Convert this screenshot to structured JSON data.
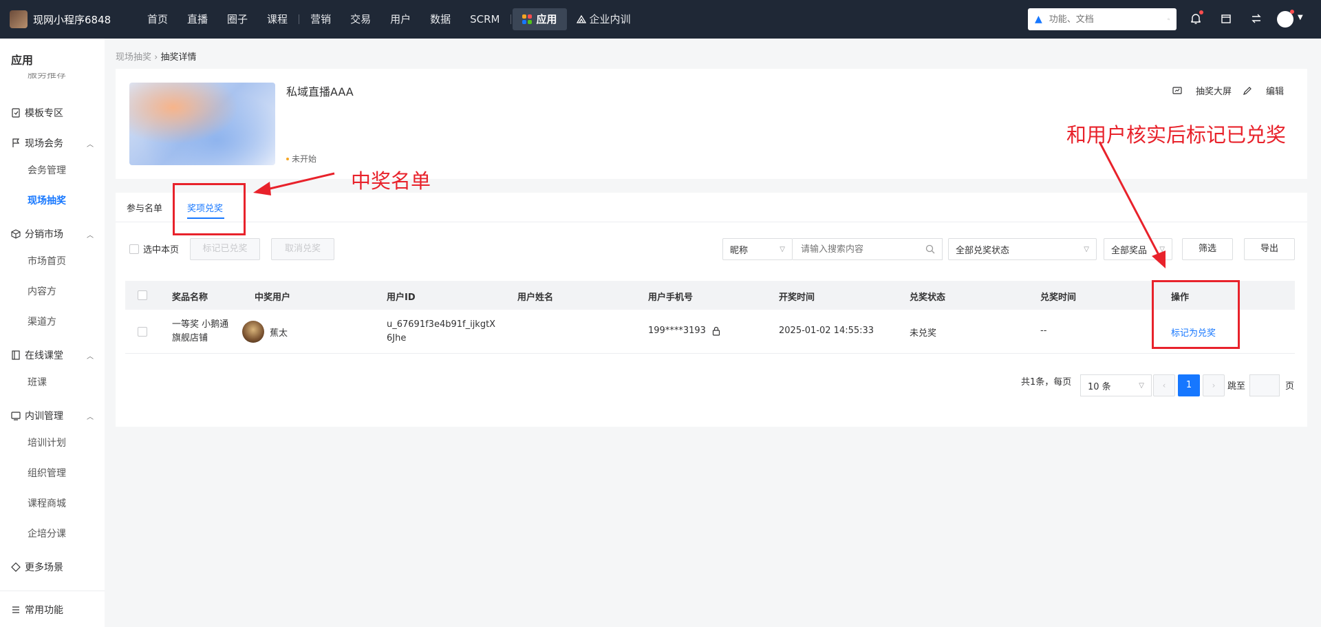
{
  "topbar": {
    "brand": "现网小程序6848",
    "nav": [
      "首页",
      "直播",
      "圈子",
      "课程",
      "营销",
      "交易",
      "用户",
      "数据",
      "SCRM"
    ],
    "nav_active": "应用",
    "nav_train": "企业内训",
    "search_placeholder": "功能、文档",
    "icons": [
      "bell-icon",
      "store-icon",
      "switch-icon",
      "avatar"
    ]
  },
  "sidebar": {
    "title": "应用",
    "clipped_item": "服务推荐",
    "template": "模板专区",
    "groups": [
      {
        "label": "现场会务",
        "items": [
          "会务管理",
          "现场抽奖"
        ]
      },
      {
        "label": "分销市场",
        "items": [
          "市场首页",
          "内容方",
          "渠道方"
        ]
      },
      {
        "label": "在线课堂",
        "items": [
          "班课"
        ]
      },
      {
        "label": "内训管理",
        "items": [
          "培训计划",
          "组织管理",
          "课程商城",
          "企培分课"
        ]
      }
    ],
    "more": "更多场景",
    "common": "常用功能"
  },
  "breadcrumb": {
    "parent": "现场抽奖",
    "current": "抽奖详情"
  },
  "live": {
    "title": "私域直播AAA",
    "status": "未开始",
    "big_screen": "抽奖大屏",
    "edit": "编辑"
  },
  "tabs": [
    "参与名单",
    "奖项兑奖"
  ],
  "toolbar": {
    "select_page": "选中本页",
    "mark_redeemed": "标记已兑奖",
    "cancel_redeem": "取消兑奖",
    "field_select": "昵称",
    "search_placeholder": "请输入搜索内容",
    "status_select": "全部兑奖状态",
    "prize_select": "全部奖品",
    "filter": "筛选",
    "export": "导出"
  },
  "table": {
    "headers": [
      "奖品名称",
      "中奖用户",
      "用户ID",
      "用户姓名",
      "用户手机号",
      "开奖时间",
      "兑奖状态",
      "兑奖时间",
      "操作"
    ],
    "rows": [
      {
        "prize_line1": "一等奖 小鹅通",
        "prize_line2": "旗舰店铺",
        "winner": "蕉太",
        "uid_line1": "u_67691f3e4b91f_ijkgtX",
        "uid_line2": "6Jhe",
        "name": "",
        "phone": "199****3193",
        "draw_time": "2025-01-02 14:55:33",
        "status": "未兑奖",
        "redeem_time": "--",
        "action": "标记为兑奖"
      }
    ]
  },
  "pagination": {
    "summary": "共1条，每页",
    "page_size": "10 条",
    "current": "1",
    "jump": "跳至",
    "unit": "页"
  },
  "annotations": {
    "winner_list": "中奖名单",
    "mark_hint": "和用户核实后标记已兑奖",
    "color": "#e8222b"
  }
}
